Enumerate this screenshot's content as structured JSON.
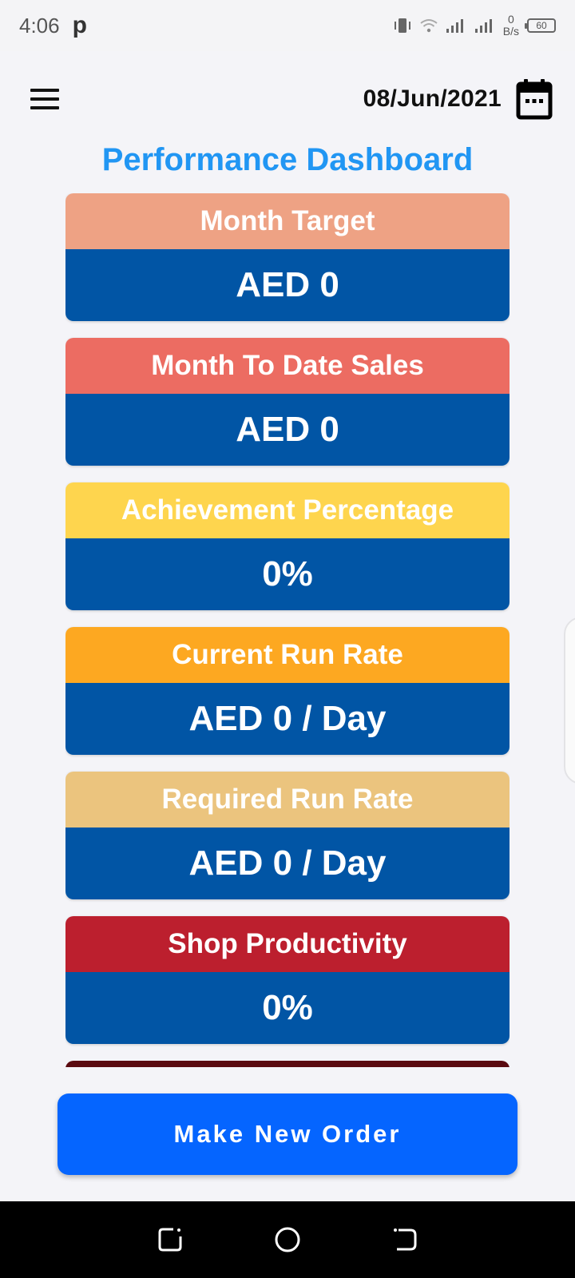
{
  "status_bar": {
    "time": "4:06",
    "app_indicator": "p",
    "net_speed_value": "0",
    "net_speed_unit": "B/s",
    "battery": "60"
  },
  "header": {
    "date": "08/Jun/2021",
    "menu_icon": "hamburger-menu-icon",
    "calendar_icon": "calendar-icon"
  },
  "page_title": "Performance Dashboard",
  "cards": [
    {
      "label": "Month Target",
      "value": "AED 0",
      "color": "#eea284"
    },
    {
      "label": "Month To Date Sales",
      "value": "AED 0",
      "color": "#ec6c62"
    },
    {
      "label": "Achievement Percentage",
      "value": "0%",
      "color": "#fed54e"
    },
    {
      "label": "Current Run Rate",
      "value": "AED 0 / Day",
      "color": "#fda821"
    },
    {
      "label": "Required Run Rate",
      "value": "AED 0 / Day",
      "color": "#ebc47e"
    },
    {
      "label": "Shop Productivity",
      "value": "0%",
      "color": "#bc1f2e"
    }
  ],
  "card_value_background": "#0155a5",
  "primary_button": {
    "label": "Make New Order",
    "color": "#0565ff"
  },
  "nav_bar": {
    "back_icon": "recent-apps-icon",
    "home_icon": "home-circle-icon",
    "recent_icon": "back-icon"
  }
}
